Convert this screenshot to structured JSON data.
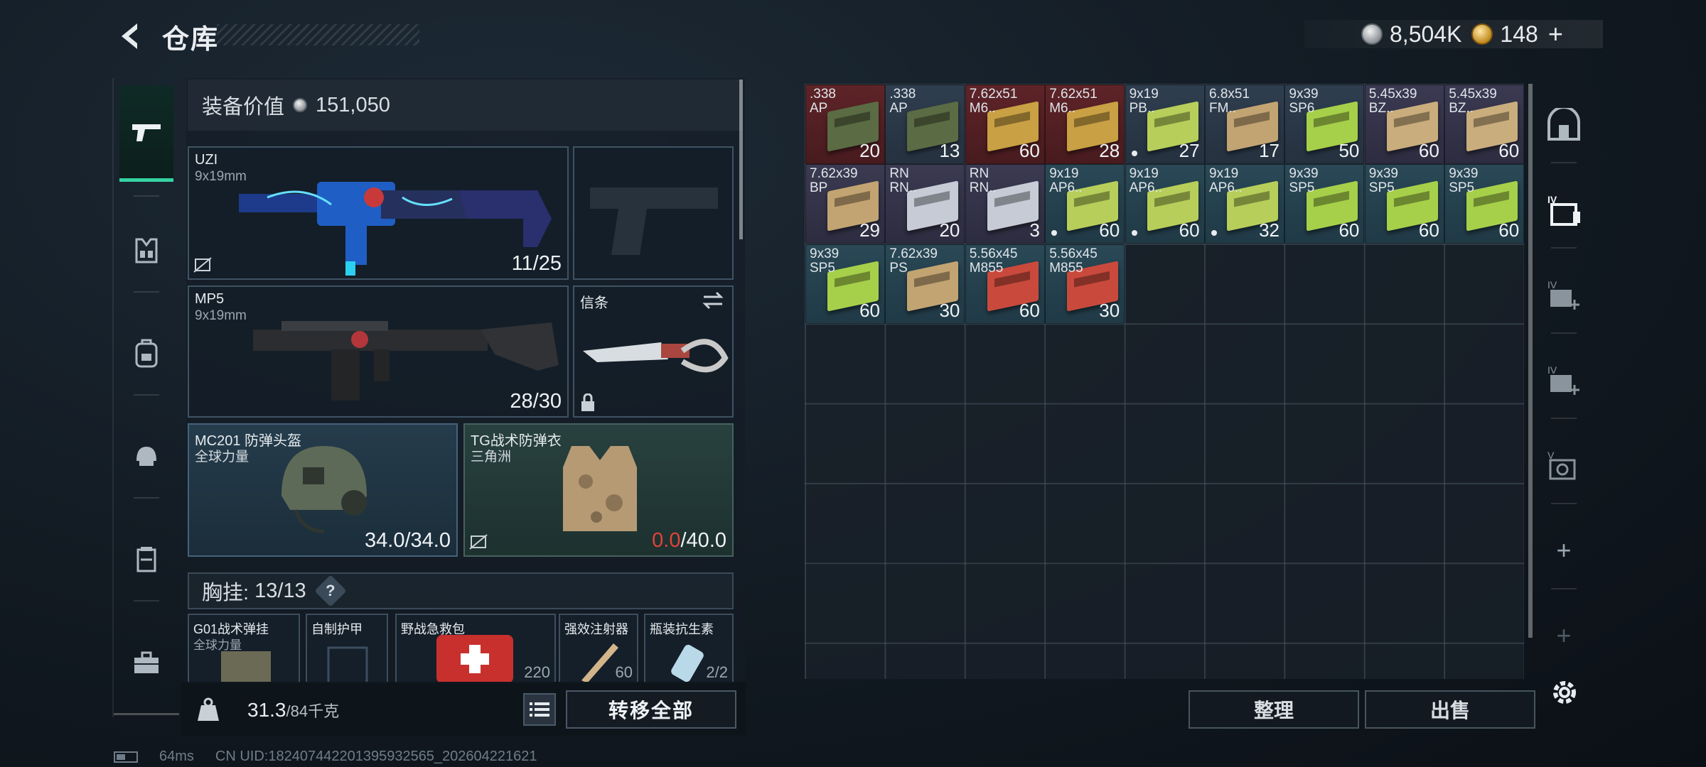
{
  "header": {
    "title": "仓库"
  },
  "currency": {
    "silver": "8,504K",
    "gold": "148",
    "plus": "+"
  },
  "loadout": {
    "value_label": "装备价值",
    "value": "151,050",
    "slots": {
      "primary": {
        "name": "UZI",
        "caliber": "9x19mm",
        "ammo": "11/25"
      },
      "secondary": {
        "name": "MP5",
        "caliber": "9x19mm",
        "ammo": "28/30"
      },
      "melee": {
        "name": "信条"
      },
      "helmet": {
        "name": "MC201 防弹头盔",
        "faction": "全球力量",
        "durability": "34.0/34.0"
      },
      "armor": {
        "name": "TG战术防弹衣",
        "faction": "三角洲",
        "durability_current": "0.0",
        "durability_max": "/40.0"
      }
    },
    "chest": {
      "label": "胸挂:",
      "capacity": "13/13",
      "help": "?"
    },
    "pockets": [
      {
        "name": "G01战术弹挂",
        "sub": "全球力量",
        "qty": ""
      },
      {
        "name": "自制护甲",
        "sub": "",
        "qty": ""
      },
      {
        "name": "野战急救包",
        "sub": "",
        "qty": "220"
      },
      {
        "name": "强效注射器",
        "sub": "",
        "qty": "60"
      },
      {
        "name": "瓶装抗生素",
        "sub": "",
        "qty": "2/2"
      }
    ],
    "weight": {
      "current": "31.3",
      "max": "/84千克"
    },
    "transfer_label": "转移全部"
  },
  "storage": {
    "items": [
      {
        "cal": ".338\nAP",
        "amt": "20",
        "color": "red",
        "box": "#5b6b44",
        "dot": false
      },
      {
        "cal": ".338\nAP",
        "amt": "13",
        "color": "dark",
        "box": "#5b6b44",
        "dot": false
      },
      {
        "cal": "7.62x51\nM6..",
        "amt": "60",
        "color": "red",
        "box": "#c9a043",
        "dot": false
      },
      {
        "cal": "7.62x51\nM6..",
        "amt": "28",
        "color": "red",
        "box": "#c9a043",
        "dot": false
      },
      {
        "cal": "9x19\nPB..",
        "amt": "27",
        "color": "dark",
        "box": "#b7cf5a",
        "dot": true
      },
      {
        "cal": "6.8x51\nFM..",
        "amt": "17",
        "color": "dark",
        "box": "#c2a472",
        "dot": false
      },
      {
        "cal": "9x39\nSP6",
        "amt": "50",
        "color": "dark",
        "box": "#a6d04a",
        "dot": false
      },
      {
        "cal": "5.45x39\nBZ..",
        "amt": "60",
        "color": "purple",
        "box": "#c9ad7d",
        "dot": false
      },
      {
        "cal": "5.45x39\nBZ..",
        "amt": "60",
        "color": "purple",
        "box": "#c9ad7d",
        "dot": false
      },
      {
        "cal": "7.62x39\nBP",
        "amt": "29",
        "color": "purple",
        "box": "#c2a472",
        "dot": false
      },
      {
        "cal": "RN\nRN..",
        "amt": "20",
        "color": "purple",
        "box": "#c7cbd6",
        "dot": false
      },
      {
        "cal": "RN\nRN..",
        "amt": "3",
        "color": "purple",
        "box": "#c7cbd6",
        "dot": false
      },
      {
        "cal": "9x19\nAP6..",
        "amt": "60",
        "color": "blue",
        "box": "#b7cf5a",
        "dot": true
      },
      {
        "cal": "9x19\nAP6..",
        "amt": "60",
        "color": "blue",
        "box": "#b7cf5a",
        "dot": true
      },
      {
        "cal": "9x19\nAP6..",
        "amt": "32",
        "color": "blue",
        "box": "#b7cf5a",
        "dot": true
      },
      {
        "cal": "9x39\nSP5",
        "amt": "60",
        "color": "blue",
        "box": "#a6d04a",
        "dot": false
      },
      {
        "cal": "9x39\nSP5",
        "amt": "60",
        "color": "blue",
        "box": "#a6d04a",
        "dot": false
      },
      {
        "cal": "9x39\nSP5",
        "amt": "60",
        "color": "blue",
        "box": "#a6d04a",
        "dot": false
      },
      {
        "cal": "9x39\nSP5",
        "amt": "60",
        "color": "blue",
        "box": "#a6d04a",
        "dot": false
      },
      {
        "cal": "7.62x39\nPS",
        "amt": "30",
        "color": "blue",
        "box": "#c2a472",
        "dot": false
      },
      {
        "cal": "5.56x45\nM855",
        "amt": "60",
        "color": "blue",
        "box": "#c94a3c",
        "dot": false
      },
      {
        "cal": "5.56x45\nM855",
        "amt": "30",
        "color": "blue",
        "box": "#c94a3c",
        "dot": false
      }
    ],
    "sort_label": "整理",
    "sell_label": "出售"
  },
  "right_rail": {
    "plus": "+"
  },
  "status": {
    "ping": "64ms",
    "uid": "CN UID:182407442201395932565_202604221621"
  }
}
